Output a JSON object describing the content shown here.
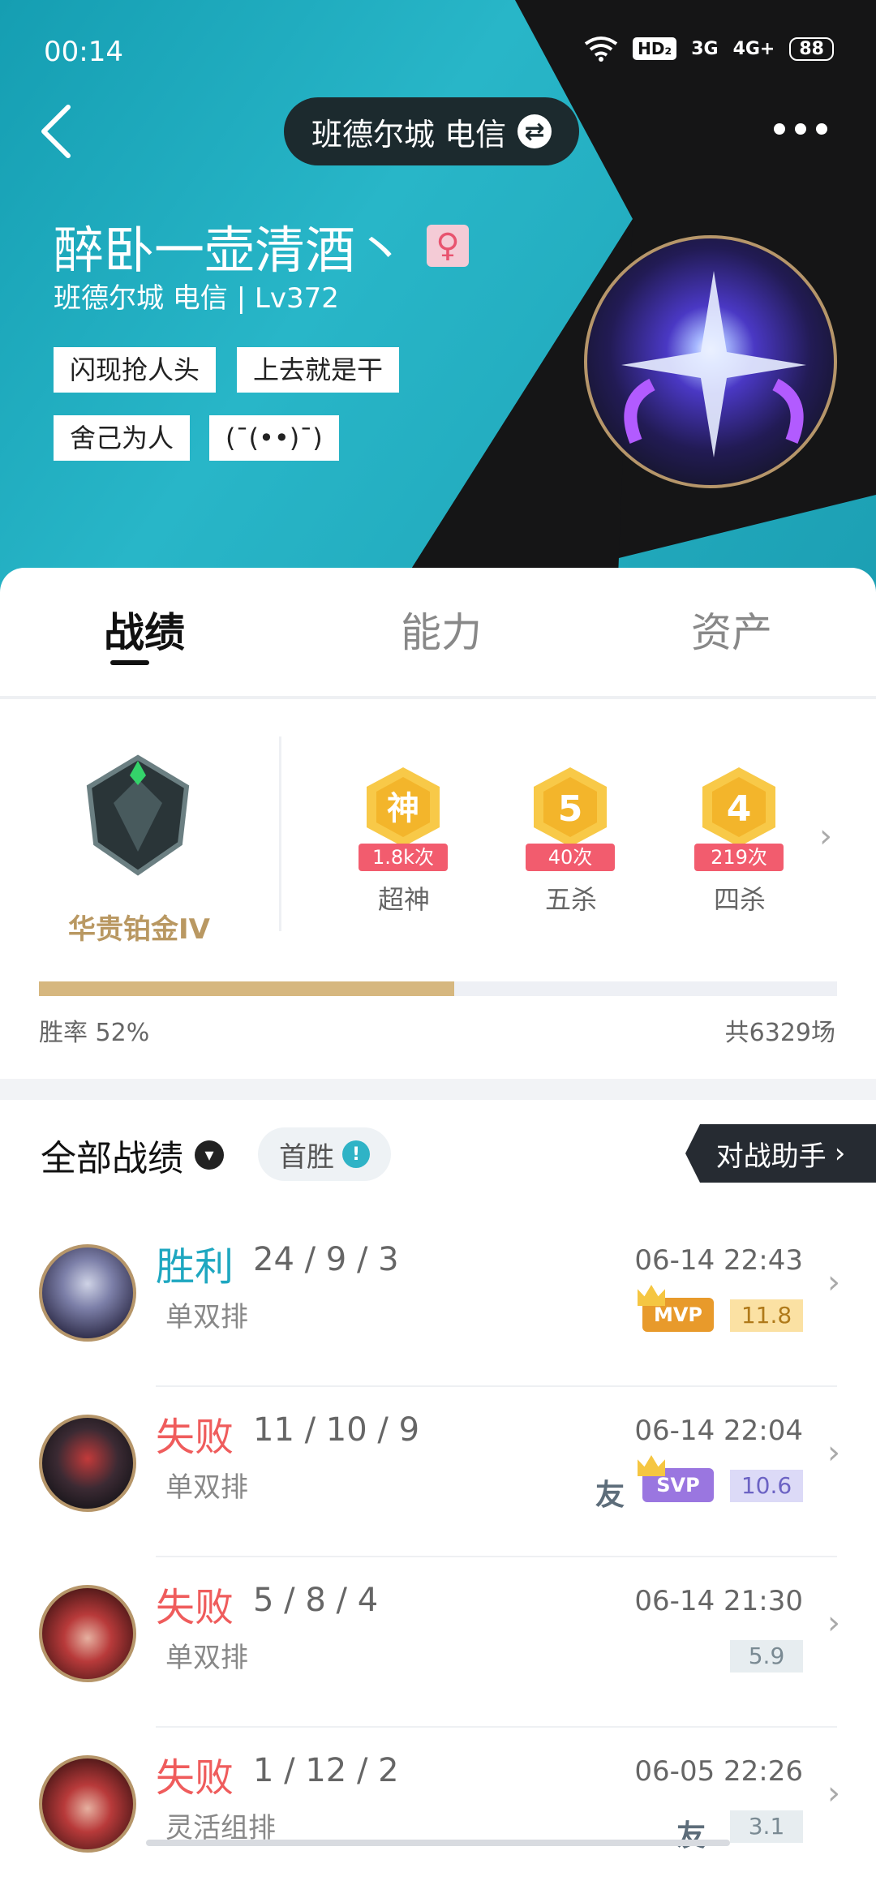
{
  "status": {
    "time": "00:14",
    "hd": "HD₂",
    "network1": "3G",
    "network2": "4G+",
    "battery": "88"
  },
  "header": {
    "server_label": "班德尔城 电信",
    "player_name": "醉卧一壶清酒丶",
    "sub_info": "班德尔城 电信 | Lv372",
    "tags": [
      "闪现抢人头",
      "上去就是干",
      "舍己为人",
      "(¯(••)¯)"
    ],
    "gender_symbol": "♀"
  },
  "tabs": [
    {
      "label": "战绩"
    },
    {
      "label": "能力"
    },
    {
      "label": "资产"
    }
  ],
  "rank": {
    "name": "华贵铂金IV"
  },
  "medals": [
    {
      "icon_text": "神",
      "count": "1.8k次",
      "label": "超神"
    },
    {
      "icon_text": "5",
      "count": "40次",
      "label": "五杀"
    },
    {
      "icon_text": "4",
      "count": "219次",
      "label": "四杀"
    }
  ],
  "stats": {
    "win_rate_label": "胜率  52%",
    "win_rate": 0.52,
    "total_games": "共6329场"
  },
  "records": {
    "title": "全部战绩",
    "first_win": "首胜",
    "assistant": "对战助手",
    "items": [
      {
        "result": "胜利",
        "kda": "24 / 9 / 3",
        "mode": "单双排",
        "time": "06-14 22:43",
        "badge": "MVP",
        "score": "11.8",
        "friend": ""
      },
      {
        "result": "失败",
        "kda": "11 / 10 / 9",
        "mode": "单双排",
        "time": "06-14 22:04",
        "badge": "SVP",
        "score": "10.6",
        "friend": "友"
      },
      {
        "result": "失败",
        "kda": "5 / 8 / 4",
        "mode": "单双排",
        "time": "06-14 21:30",
        "badge": "",
        "score": "5.9",
        "friend": ""
      },
      {
        "result": "失败",
        "kda": "1 / 12 / 2",
        "mode": "灵活组排",
        "time": "06-05 22:26",
        "badge": "",
        "score": "3.1",
        "friend": "友"
      }
    ]
  },
  "colors": {
    "win": "#1ea7c0",
    "lose": "#ef5c5c",
    "gold": "#b99862",
    "mvp": "#e89a2b",
    "svp": "#9a76e0"
  }
}
